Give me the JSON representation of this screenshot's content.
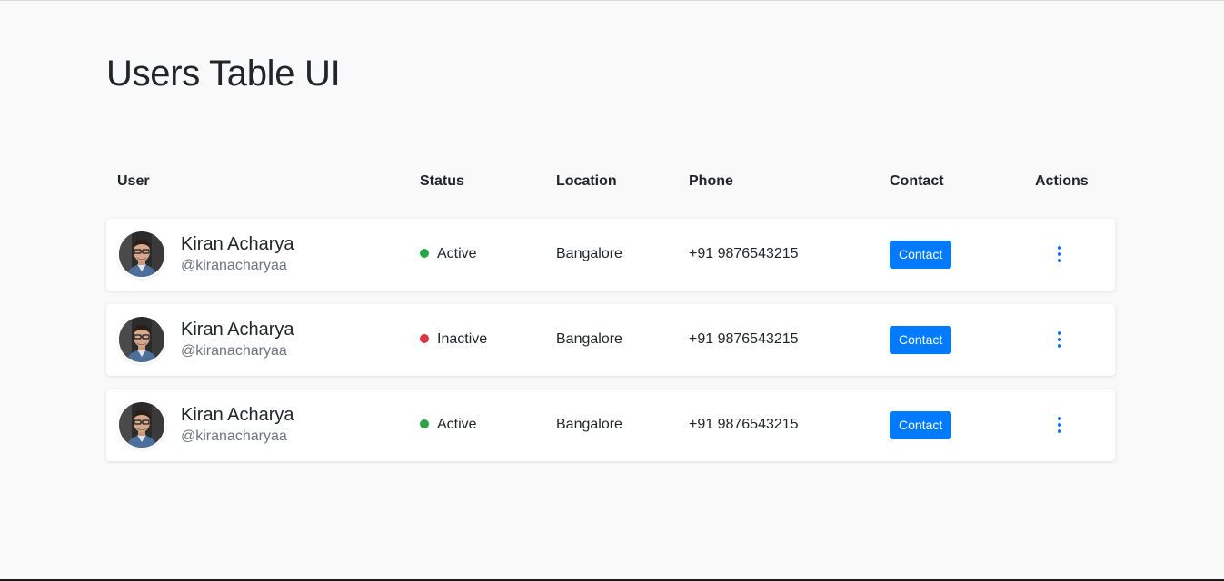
{
  "page": {
    "title": "Users Table UI"
  },
  "table": {
    "headers": {
      "user": "User",
      "status": "Status",
      "location": "Location",
      "phone": "Phone",
      "contact": "Contact",
      "actions": "Actions"
    },
    "rows": [
      {
        "name": "Kiran Acharya",
        "handle": "@kiranacharyaa",
        "status": "Active",
        "status_color": "#28a745",
        "location": "Bangalore",
        "phone": "+91 9876543215",
        "contact_label": "Contact",
        "avatar_icon": "user-avatar-photo",
        "actions_icon": "more-vertical-icon"
      },
      {
        "name": "Kiran Acharya",
        "handle": "@kiranacharyaa",
        "status": "Inactive",
        "status_color": "#dc3545",
        "location": "Bangalore",
        "phone": "+91 9876543215",
        "contact_label": "Contact",
        "avatar_icon": "user-avatar-photo",
        "actions_icon": "more-vertical-icon"
      },
      {
        "name": "Kiran Acharya",
        "handle": "@kiranacharyaa",
        "status": "Active",
        "status_color": "#28a745",
        "location": "Bangalore",
        "phone": "+91 9876543215",
        "contact_label": "Contact",
        "avatar_icon": "user-avatar-photo",
        "actions_icon": "more-vertical-icon"
      }
    ]
  },
  "colors": {
    "background": "#f9f9f9",
    "accent": "#007bff",
    "active": "#28a745",
    "inactive": "#dc3545"
  }
}
